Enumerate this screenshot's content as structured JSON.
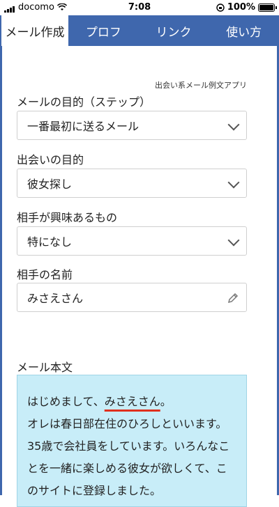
{
  "status": {
    "carrier": "docomo",
    "time": "7:08",
    "battery": "100%"
  },
  "tabs": [
    {
      "label": "メール作成"
    },
    {
      "label": "プロフ"
    },
    {
      "label": "リンク"
    },
    {
      "label": "使い方"
    }
  ],
  "caption": "出会い系メール例文アプリ",
  "fields": {
    "purpose_step": {
      "label": "メールの目的（ステップ）",
      "value": "一番最初に送るメール"
    },
    "meeting_purpose": {
      "label": "出会いの目的",
      "value": "彼女探し"
    },
    "interest": {
      "label": "相手が興味あるもの",
      "value": "特になし"
    },
    "name": {
      "label": "相手の名前",
      "value": "みさえさん"
    }
  },
  "body": {
    "label": "メール本文",
    "greeting_before": "はじめまして、",
    "greeting_name": "みさえさん",
    "greeting_after": "。",
    "text": "オレは春日部在住のひろしといいます。35歳で会社員をしています。いろんなことを一緒に楽しめる彼女が欲しくて、このサイトに登録しました。"
  },
  "colors": {
    "accent": "#3f67ad",
    "body_bg": "#c8edf8",
    "underline": "#e0301e"
  }
}
